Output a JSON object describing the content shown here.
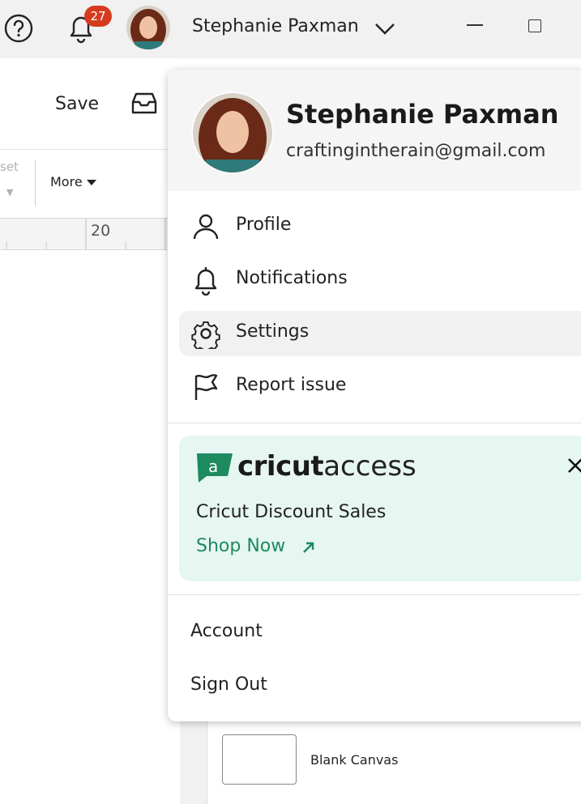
{
  "topbar": {
    "notification_count": "27",
    "user_name": "Stephanie Paxman"
  },
  "toolbar": {
    "save_label": "Save",
    "more_label": "More",
    "partial_set_label": "set",
    "ruler_number": "20"
  },
  "canvas_panel": {
    "blank_canvas_label": "Blank Canvas"
  },
  "menu": {
    "user_name": "Stephanie Paxman",
    "user_email": "craftingintherain@gmail.com",
    "items": [
      {
        "label": "Profile",
        "icon": "user-icon"
      },
      {
        "label": "Notifications",
        "icon": "bell-icon"
      },
      {
        "label": "Settings",
        "icon": "gear-icon",
        "active": true
      },
      {
        "label": "Report issue",
        "icon": "flag-icon"
      }
    ],
    "promo": {
      "brand_bold": "cricut",
      "brand_light": "access",
      "title": "Cricut Discount Sales",
      "link": "Shop Now",
      "accent_color": "#1d8a5f",
      "background_color": "#e6f6f1"
    },
    "account_label": "Account",
    "signout_label": "Sign Out"
  },
  "colors": {
    "badge": "#d63b1f",
    "topbar_bg": "#f1f1f1"
  }
}
